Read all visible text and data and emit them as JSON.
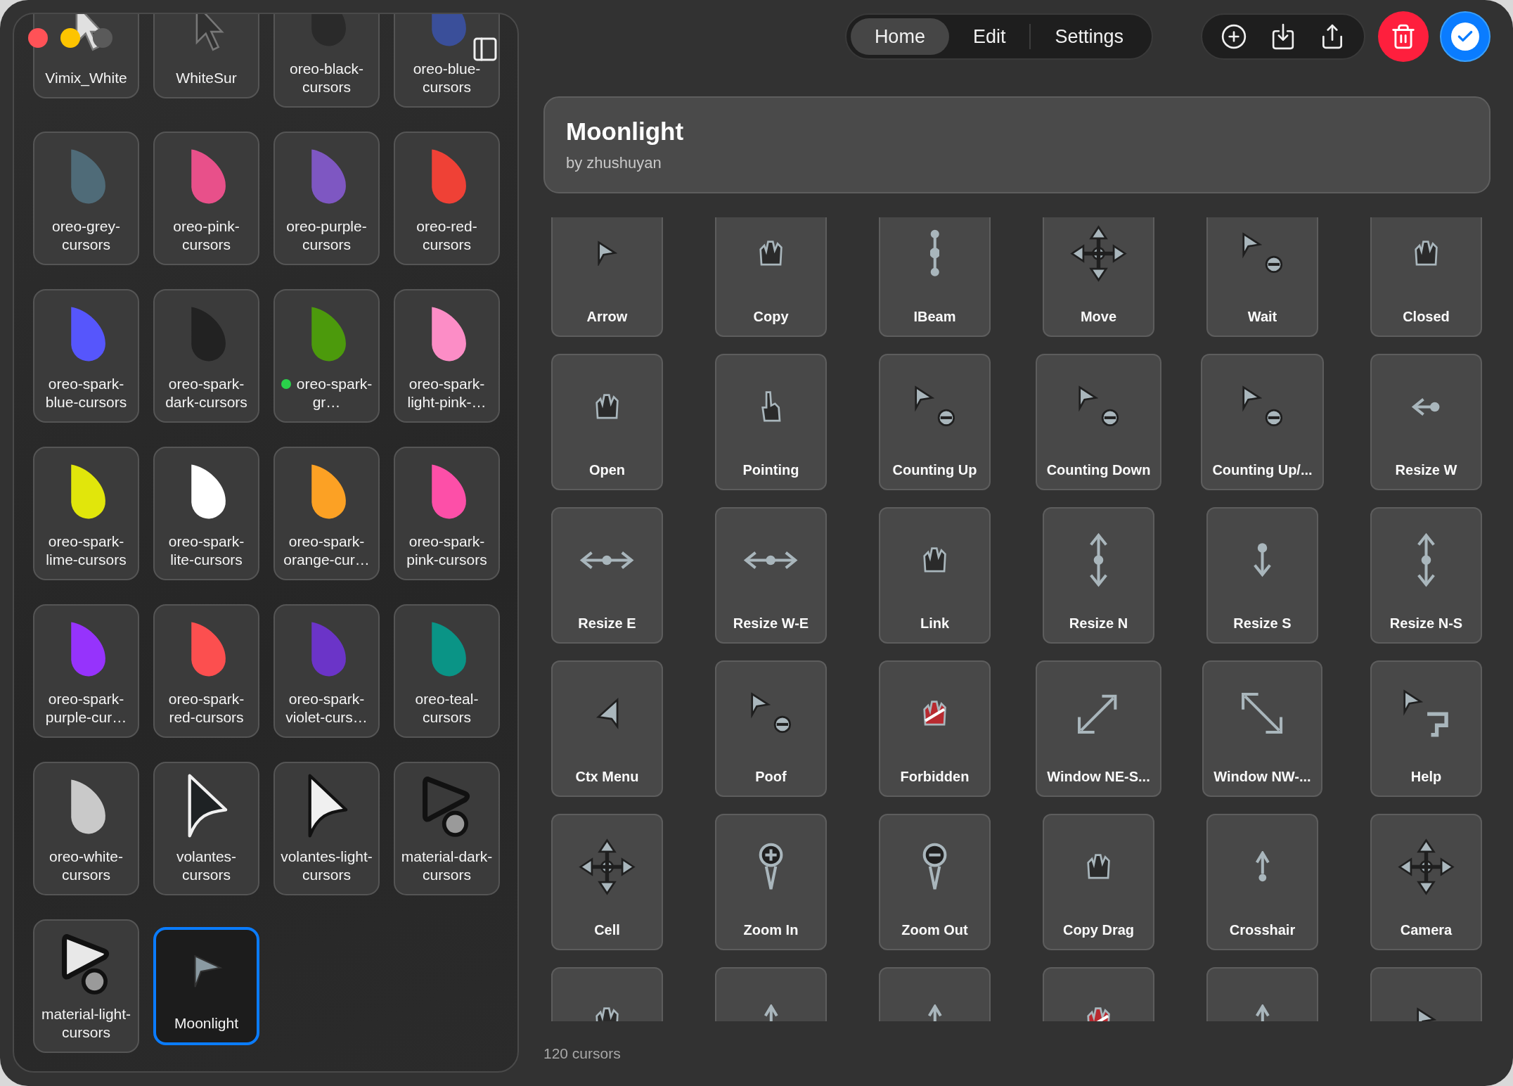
{
  "window": {
    "controls": [
      {
        "kind": "close"
      },
      {
        "kind": "minimize"
      },
      {
        "kind": "zoom"
      }
    ]
  },
  "toolbar": {
    "tabs": [
      {
        "label": "Home",
        "selected": true
      },
      {
        "label": "Edit",
        "selected": false
      },
      {
        "label": "Settings",
        "selected": false
      }
    ]
  },
  "sidebar": {
    "themes": [
      {
        "label": "Vimix_White",
        "kind": "arrow",
        "color": "#e0e0e0",
        "selected": false,
        "dot": false
      },
      {
        "label": "WhiteSur",
        "kind": "arrow",
        "color": "#303030",
        "selected": false,
        "dot": false
      },
      {
        "label": "oreo-black-cursors",
        "kind": "drop",
        "color": "#2a2a2a",
        "selected": false,
        "dot": false
      },
      {
        "label": "oreo-blue-cursors",
        "kind": "drop",
        "color": "#3a4f9a",
        "selected": false,
        "dot": false
      },
      {
        "label": "oreo-grey-cursors",
        "kind": "drop",
        "color": "#4f6b78",
        "selected": false,
        "dot": false
      },
      {
        "label": "oreo-pink-cursors",
        "kind": "drop",
        "color": "#e8508a",
        "selected": false,
        "dot": false
      },
      {
        "label": "oreo-purple-cursors",
        "kind": "drop",
        "color": "#7e57c2",
        "selected": false,
        "dot": false
      },
      {
        "label": "oreo-red-cursors",
        "kind": "drop",
        "color": "#ef4136",
        "selected": false,
        "dot": false
      },
      {
        "label": "oreo-spark-blue-cursors",
        "kind": "drop",
        "color": "#5656fc",
        "selected": false,
        "dot": false
      },
      {
        "label": "oreo-spark-dark-cursors",
        "kind": "drop",
        "color": "#222222",
        "selected": false,
        "dot": false
      },
      {
        "label": "oreo-spark-gr…",
        "kind": "drop",
        "color": "#4c9a0c",
        "selected": false,
        "dot": true
      },
      {
        "label": "oreo-spark-light-pink-…",
        "kind": "drop",
        "color": "#fc8dc6",
        "selected": false,
        "dot": false
      },
      {
        "label": "oreo-spark-lime-cursors",
        "kind": "drop",
        "color": "#e1e60b",
        "selected": false,
        "dot": false
      },
      {
        "label": "oreo-spark-lite-cursors",
        "kind": "drop",
        "color": "#ffffff",
        "selected": false,
        "dot": false
      },
      {
        "label": "oreo-spark-orange-cur…",
        "kind": "drop",
        "color": "#fca124",
        "selected": false,
        "dot": false
      },
      {
        "label": "oreo-spark-pink-cursors",
        "kind": "drop",
        "color": "#fd4fa8",
        "selected": false,
        "dot": false
      },
      {
        "label": "oreo-spark-purple-cur…",
        "kind": "drop",
        "color": "#9633fc",
        "selected": false,
        "dot": false
      },
      {
        "label": "oreo-spark-red-cursors",
        "kind": "drop",
        "color": "#fc4f4f",
        "selected": false,
        "dot": false
      },
      {
        "label": "oreo-spark-violet-curs…",
        "kind": "drop",
        "color": "#6b34c8",
        "selected": false,
        "dot": false
      },
      {
        "label": "oreo-teal-cursors",
        "kind": "drop",
        "color": "#0a9486",
        "selected": false,
        "dot": false
      },
      {
        "label": "oreo-white-cursors",
        "kind": "drop",
        "color": "#c9c9c9",
        "selected": false,
        "dot": false
      },
      {
        "label": "volantes-cursors",
        "kind": "outline-arrow",
        "color": "#1e2224",
        "selected": false,
        "dot": false
      },
      {
        "label": "volantes-light-cursors",
        "kind": "outline-arrow",
        "color": "#f0f0f0",
        "selected": false,
        "dot": false
      },
      {
        "label": "material-dark-cursors",
        "kind": "material",
        "color": "#3a3a3a",
        "selected": false,
        "dot": false
      },
      {
        "label": "material-light-cursors",
        "kind": "material",
        "color": "#e8e8e8",
        "selected": false,
        "dot": false
      },
      {
        "label": "Moonlight",
        "kind": "small-arrow",
        "color": "#8a9aa2",
        "selected": true,
        "dot": false
      }
    ]
  },
  "theme": {
    "title": "Moonlight",
    "author": "by zhushuyan"
  },
  "cursors": [
    {
      "label": "Arrow",
      "kind": "arrow"
    },
    {
      "label": "Copy",
      "kind": "hand"
    },
    {
      "label": "IBeam",
      "kind": "ibeam"
    },
    {
      "label": "Move",
      "kind": "move"
    },
    {
      "label": "Wait",
      "kind": "wait"
    },
    {
      "label": "Closed",
      "kind": "hand"
    },
    {
      "label": "Open",
      "kind": "hand"
    },
    {
      "label": "Pointing",
      "kind": "pointing"
    },
    {
      "label": "Counting Up",
      "kind": "wait"
    },
    {
      "label": "Counting Down",
      "kind": "wait"
    },
    {
      "label": "Counting Up/...",
      "kind": "wait"
    },
    {
      "label": "Resize W",
      "kind": "resize-w"
    },
    {
      "label": "Resize E",
      "kind": "resize-ew"
    },
    {
      "label": "Resize W-E",
      "kind": "resize-ew"
    },
    {
      "label": "Link",
      "kind": "hand"
    },
    {
      "label": "Resize N",
      "kind": "resize-ns"
    },
    {
      "label": "Resize S",
      "kind": "resize-s"
    },
    {
      "label": "Resize N-S",
      "kind": "resize-ns"
    },
    {
      "label": "Ctx Menu",
      "kind": "ctx"
    },
    {
      "label": "Poof",
      "kind": "wait"
    },
    {
      "label": "Forbidden",
      "kind": "forbidden"
    },
    {
      "label": "Window NE-S...",
      "kind": "diag-ne"
    },
    {
      "label": "Window NW-...",
      "kind": "diag-nw"
    },
    {
      "label": "Help",
      "kind": "help"
    },
    {
      "label": "Cell",
      "kind": "move"
    },
    {
      "label": "Zoom In",
      "kind": "zoom-in"
    },
    {
      "label": "Zoom Out",
      "kind": "zoom-out"
    },
    {
      "label": "Copy Drag",
      "kind": "hand"
    },
    {
      "label": "Crosshair",
      "kind": "up"
    },
    {
      "label": "Camera",
      "kind": "move"
    },
    {
      "kind": "hand"
    },
    {
      "kind": "up"
    },
    {
      "kind": "up"
    },
    {
      "kind": "forbidden"
    },
    {
      "kind": "up"
    },
    {
      "kind": "arrow"
    }
  ],
  "footer": {
    "count": "120 cursors"
  }
}
